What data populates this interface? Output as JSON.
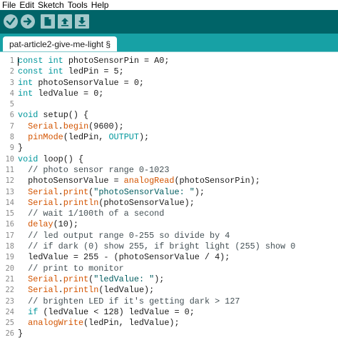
{
  "menu": [
    "File",
    "Edit",
    "Sketch",
    "Tools",
    "Help"
  ],
  "toolbar": {
    "verify_icon": "checkmark-icon",
    "upload_icon": "right-arrow-icon",
    "new_icon": "new-file-icon",
    "open_icon": "open-arrow-up-icon",
    "save_icon": "save-arrow-down-icon"
  },
  "tab": {
    "label": "pat-article2-give-me-light §"
  },
  "colors": {
    "toolbar_bg": "#006468",
    "tabbar_bg": "#17a1a5",
    "keyword": "#00979c",
    "function": "#d35400"
  },
  "code_lines": [
    {
      "n": "1",
      "t": "const int photoSensorPin = A0;"
    },
    {
      "n": "2",
      "t": "const int ledPin = 5;"
    },
    {
      "n": "3",
      "t": "int photoSensorValue = 0;"
    },
    {
      "n": "4",
      "t": "int ledValue = 0;"
    },
    {
      "n": "5",
      "t": ""
    },
    {
      "n": "6",
      "t": "void setup() {"
    },
    {
      "n": "7",
      "t": "  Serial.begin(9600);"
    },
    {
      "n": "8",
      "t": "  pinMode(ledPin, OUTPUT);"
    },
    {
      "n": "9",
      "t": "}"
    },
    {
      "n": "10",
      "t": "void loop() {"
    },
    {
      "n": "11",
      "t": "  // photo sensor range 0-1023"
    },
    {
      "n": "12",
      "t": "  photoSensorValue = analogRead(photoSensorPin);"
    },
    {
      "n": "13",
      "t": "  Serial.print(\"photoSensorValue: \");"
    },
    {
      "n": "14",
      "t": "  Serial.println(photoSensorValue);"
    },
    {
      "n": "15",
      "t": "  // wait 1/100th of a second"
    },
    {
      "n": "16",
      "t": "  delay(10);"
    },
    {
      "n": "17",
      "t": "  // led output range 0-255 so divide by 4"
    },
    {
      "n": "18",
      "t": "  // if dark (0) show 255, if bright light (255) show 0"
    },
    {
      "n": "19",
      "t": "  ledValue = 255 - (photoSensorValue / 4);"
    },
    {
      "n": "20",
      "t": "  // print to monitor"
    },
    {
      "n": "21",
      "t": "  Serial.print(\"ledValue: \");"
    },
    {
      "n": "22",
      "t": "  Serial.println(ledValue);"
    },
    {
      "n": "23",
      "t": "  // brighten LED if it's getting dark > 127"
    },
    {
      "n": "24",
      "t": "  if (ledValue < 128) ledValue = 0;"
    },
    {
      "n": "25",
      "t": "  analogWrite(ledPin, ledValue);"
    },
    {
      "n": "26",
      "t": "}"
    }
  ]
}
